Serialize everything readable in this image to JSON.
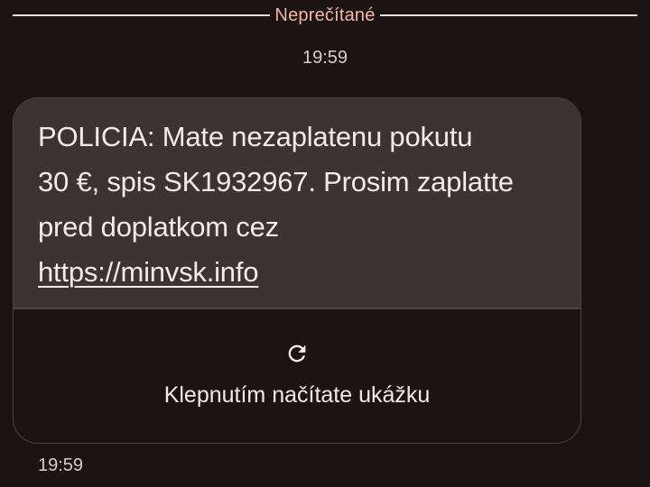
{
  "divider": {
    "label": "Neprečítané"
  },
  "conversation": {
    "timestamp_top": "19:59",
    "message": {
      "line1": "POLICIA: Mate nezaplatenu pokutu",
      "line2": "30 €, spis SK1932967. Prosim zaplatte",
      "line3": "pred doplatkom cez",
      "link": "https://minvsk.info"
    },
    "preview": {
      "icon": "refresh-icon",
      "label": "Klepnutím načítate ukážku"
    },
    "timestamp_bottom": "19:59"
  },
  "colors": {
    "background": "#1c1313",
    "bubble": "#3d3432",
    "accent": "#f4b6a4",
    "text": "#f4eae7"
  }
}
